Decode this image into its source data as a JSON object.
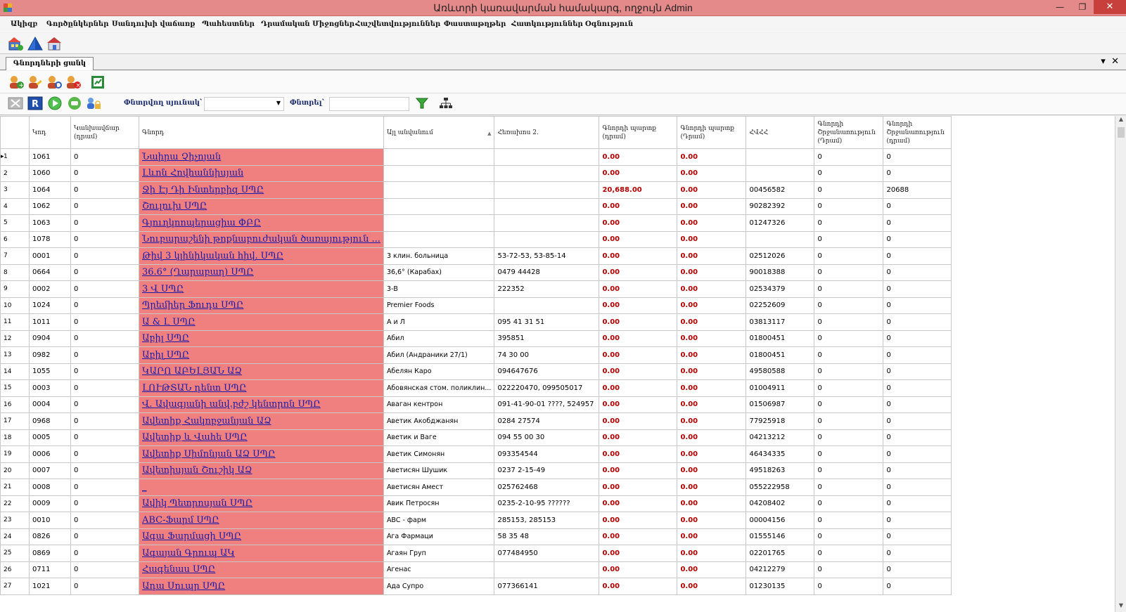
{
  "window": {
    "title": "Առևտրի կառավարման համակարգ, ողջույն Admin",
    "controls": [
      "—",
      "❐",
      "✕"
    ]
  },
  "menu": [
    "Ակիզբ",
    "Գործընկերներ",
    "Սանդուխի վաճառք",
    "Պահեստներ",
    "Դրամական Միջոցներ",
    "Հաշվետվություններ",
    "Փաստաթղթեր",
    "Հատկություններ",
    "Օգնություն"
  ],
  "tab": {
    "label": "Գնորդների ցանկ"
  },
  "filter": {
    "column_label": "Փնտրվող սյունակ՝",
    "search_label": "Փնտրել՝",
    "column_value": "",
    "search_value": ""
  },
  "table": {
    "columns": [
      "",
      "Կոդ",
      "Կանխավճար (դրամ)",
      "Գնորդ",
      "Այլ անվանում",
      "Հեռախոս 2.",
      "Գնորդի պարտք (դրամ)",
      "Գնորդի պարտք (Դրամ)",
      "ՀՎՀՀ",
      "Գնորդի Շրջանառություն (Դրամ)",
      "Գնորդի Շրջանառություն (դրամ)"
    ],
    "rows": [
      [
        "1",
        "1061",
        "0",
        "Նաիրա Չիչոյան",
        "",
        "",
        "0.00",
        "0.00",
        "",
        "0",
        "0"
      ],
      [
        "2",
        "1060",
        "0",
        "Լևոն Հովհաննիսյան",
        "",
        "",
        "0.00",
        "0.00",
        "",
        "0",
        "0"
      ],
      [
        "3",
        "1064",
        "0",
        "Ջի Էյ Դի Ինտերբիզ ՍՊԸ",
        "",
        "",
        "20,688.00",
        "0.00",
        "00456582",
        "0",
        "20688"
      ],
      [
        "4",
        "1062",
        "0",
        "Շուլուխ ՍՊԸ",
        "",
        "",
        "0.00",
        "0.00",
        "90282392",
        "0",
        "0"
      ],
      [
        "5",
        "1063",
        "0",
        "Գյուղկոոպերացիա ՓԲԸ",
        "",
        "",
        "0.00",
        "0.00",
        "01247326",
        "0",
        "0"
      ],
      [
        "6",
        "1078",
        "0",
        "Նուբարաշենի թոքնաբուժական ծառայություն ...",
        "",
        "",
        "0.00",
        "0.00",
        "",
        "0",
        "0"
      ],
      [
        "7",
        "0001",
        "0",
        "Թիվ 3 կլինիկական հիվ. ՍՊԸ",
        "3 клин. больница",
        "53-72-53, 53-85-14",
        "0.00",
        "0.00",
        "02512026",
        "0",
        "0"
      ],
      [
        "8",
        "0664",
        "0",
        "36.6° (Ղարաբաղ) ՍՊԸ",
        "36,6° (Карабах)",
        "0479 44428",
        "0.00",
        "0.00",
        "90018388",
        "0",
        "0"
      ],
      [
        "9",
        "0002",
        "0",
        "3 Վ ՍՊԸ",
        "3-В",
        "222352",
        "0.00",
        "0.00",
        "02534379",
        "0",
        "0"
      ],
      [
        "10",
        "1024",
        "0",
        "Պրեմիեր Ֆուդս ՍՊԸ",
        "Premier Foods",
        "",
        "0.00",
        "0.00",
        "02252609",
        "0",
        "0"
      ],
      [
        "11",
        "1011",
        "0",
        "Ա & Լ ՍՊԸ",
        "А и Л",
        "095 41 31 51",
        "0.00",
        "0.00",
        "03813117",
        "0",
        "0"
      ],
      [
        "12",
        "0904",
        "0",
        "Աբիլ ՍՊԸ",
        "Абил",
        "395851",
        "0.00",
        "0.00",
        "01800451",
        "0",
        "0"
      ],
      [
        "13",
        "0982",
        "0",
        "Աբիլ ՍՊԸ",
        "Абил (Андраники 27/1)",
        "74 30 00",
        "0.00",
        "0.00",
        "01800451",
        "0",
        "0"
      ],
      [
        "14",
        "1055",
        "0",
        "ԿԱՐՈ ԱԲԵԼՅԱՆ ԱՁ",
        "Абелян Каро",
        "094647676",
        "0.00",
        "0.00",
        "49580588",
        "0",
        "0"
      ],
      [
        "15",
        "0003",
        "0",
        "ԼՈՒԹՏԱՆ դենտ ՍՊԸ",
        "Абовянская стом. поликлин...",
        "022220470, 099505017",
        "0.00",
        "0.00",
        "01004911",
        "0",
        "0"
      ],
      [
        "16",
        "0004",
        "0",
        "Վ. Ավագյանի անվ.բժշ կենտրոն ՍՊԸ",
        "Аваган кентрон",
        "091-41-90-01 ????, 524957",
        "0.00",
        "0.00",
        "01506987",
        "0",
        "0"
      ],
      [
        "17",
        "0968",
        "0",
        "Ավետիք Հակոբջանյան  ԱՁ",
        "Аветик Акобджанян",
        "0284 27574",
        "0.00",
        "0.00",
        "77925918",
        "0",
        "0"
      ],
      [
        "18",
        "0005",
        "0",
        "Ավետիք և Վաhե ՍՊԸ",
        "Аветик и Ваге",
        "094 55 00 30",
        "0.00",
        "0.00",
        "04213212",
        "0",
        "0"
      ],
      [
        "19",
        "0006",
        "0",
        " Ավետիք Սիմոնյան  ԱՁ ՍՊԸ",
        "Аветик Симонян",
        "093354544",
        "0.00",
        "0.00",
        "46434335",
        "0",
        "0"
      ],
      [
        "20",
        "0007",
        "0",
        "Ավետիսյան Շուշիկ ԱՁ",
        "Аветисян  Шушик",
        "0237 2-15-49",
        "0.00",
        "0.00",
        "49518263",
        "0",
        "0"
      ],
      [
        "21",
        "0008",
        "0",
        "_",
        "Аветисян Амест",
        "025762468",
        "0.00",
        "0.00",
        "055222958",
        "0",
        "0"
      ],
      [
        "22",
        "0009",
        "0",
        " Ավիկ Պետրոսյան  ՍՊԸ",
        "Авик Петросян",
        "0235-2-10-95 ??????",
        "0.00",
        "0.00",
        "04208402",
        "0",
        "0"
      ],
      [
        "23",
        "0010",
        "0",
        "ABC-Ֆարմ ՍՊԸ",
        "ABC - фарм",
        "285153, 285153",
        "0.00",
        "0.00",
        "00004156",
        "0",
        "0"
      ],
      [
        "24",
        "0826",
        "0",
        "Ագա Ֆարմացի ՍՊԸ",
        "Ага Фармаци",
        "58 35 48",
        "0.00",
        "0.00",
        "01555146",
        "0",
        "0"
      ],
      [
        "25",
        "0869",
        "0",
        "Ագայան Գրուպ ԱԿ",
        "Агаян Груп",
        "077484950",
        "0.00",
        "0.00",
        "02201765",
        "0",
        "0"
      ],
      [
        "26",
        "0711",
        "0",
        "Հագենաս ՍՊԸ",
        "Агенас",
        "",
        "0.00",
        "0.00",
        "04212279",
        "0",
        "0"
      ],
      [
        "27",
        "1021",
        "0",
        "Ադա Սուպր ՍՊԸ",
        "Ада Супро",
        "077366141",
        "0.00",
        "0.00",
        "01230135",
        "0",
        "0"
      ]
    ]
  }
}
